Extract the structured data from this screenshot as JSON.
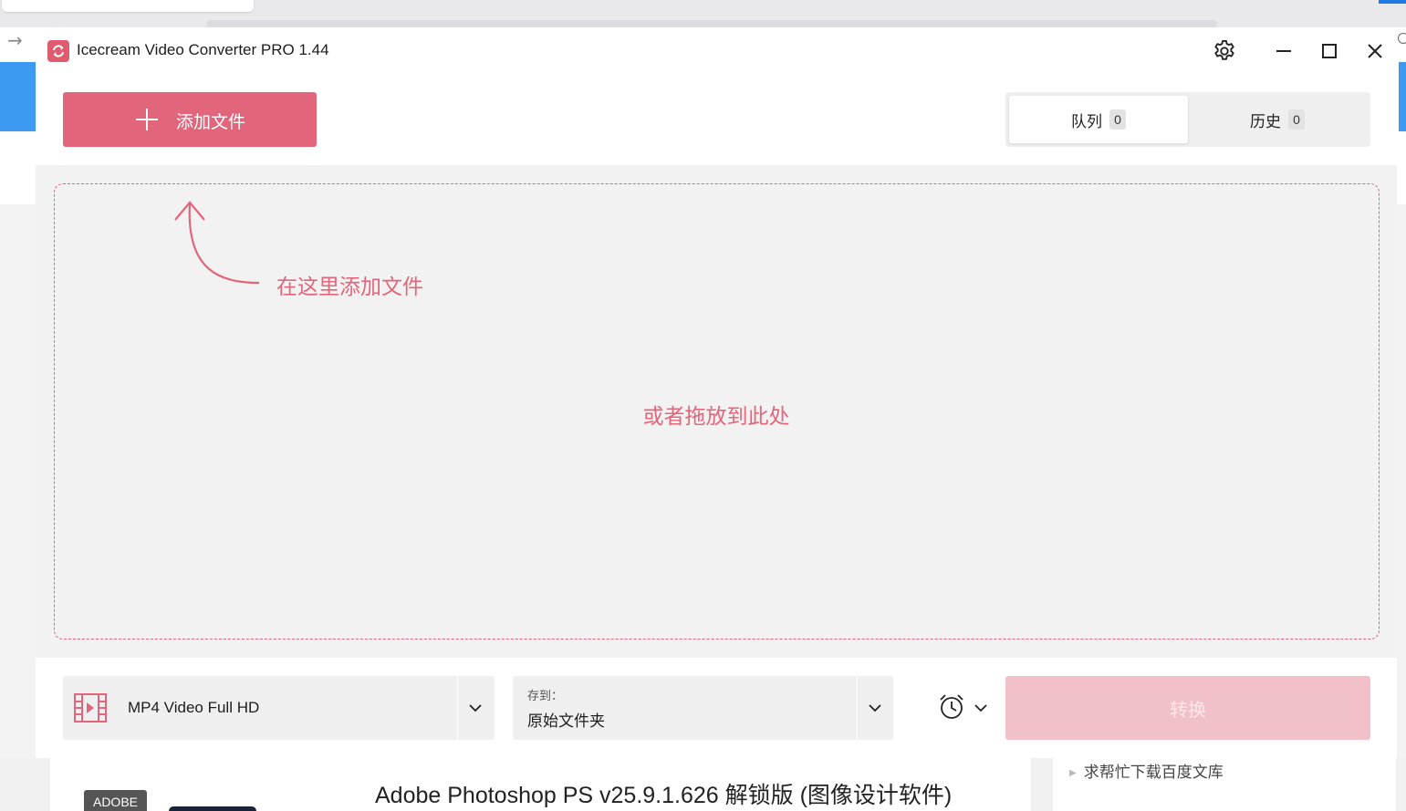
{
  "app": {
    "title": "Icecream Video Converter PRO 1.44",
    "accent_color": "#e2667b"
  },
  "toolbar": {
    "add_file_label": "添加文件",
    "tabs": [
      {
        "label": "队列",
        "count": "0",
        "active": true
      },
      {
        "label": "历史",
        "count": "0",
        "active": false
      }
    ]
  },
  "drop_zone": {
    "hint_add": "在这里添加文件",
    "hint_drop": "或者拖放到此处"
  },
  "bottom": {
    "format_value": "MP4 Video Full HD",
    "save_caption": "存到：",
    "save_value": "原始文件夹",
    "convert_label": "转换"
  },
  "background_page": {
    "tag": "ADOBE",
    "article_title": "Adobe Photoshop PS v25.9.1.626 解锁版 (图像设计软件)",
    "side_link": "求帮忙下载百度文库"
  },
  "icons": [
    "app-logo-icon",
    "gear-icon",
    "minimize-icon",
    "maximize-icon",
    "close-icon",
    "plus-icon",
    "curved-arrow-icon",
    "film-icon",
    "chevron-down-icon",
    "alarm-clock-icon",
    "back-arrow-icon"
  ]
}
